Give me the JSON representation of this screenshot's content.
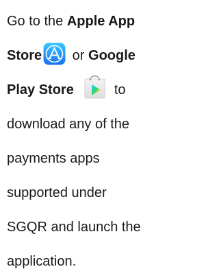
{
  "instruction": {
    "line1_prefix": "Go to the ",
    "line1_bold": "Apple App",
    "line2_bold": "Store",
    "line2_middle": " or ",
    "line2_bold2": "Google",
    "line3_bold": "Play Store",
    "line3_suffix": "to",
    "line4": "download any of the",
    "line5": "payments apps",
    "line6": "supported under",
    "line7": "SGQR and launch the",
    "line8": "application."
  },
  "icons": {
    "app_store": "app-store-icon",
    "play_store": "google-play-store-icon"
  },
  "colors": {
    "text": "#1a1a1a",
    "app_store_blue": "#1e90f0",
    "play_store_green": "#3bccff"
  }
}
